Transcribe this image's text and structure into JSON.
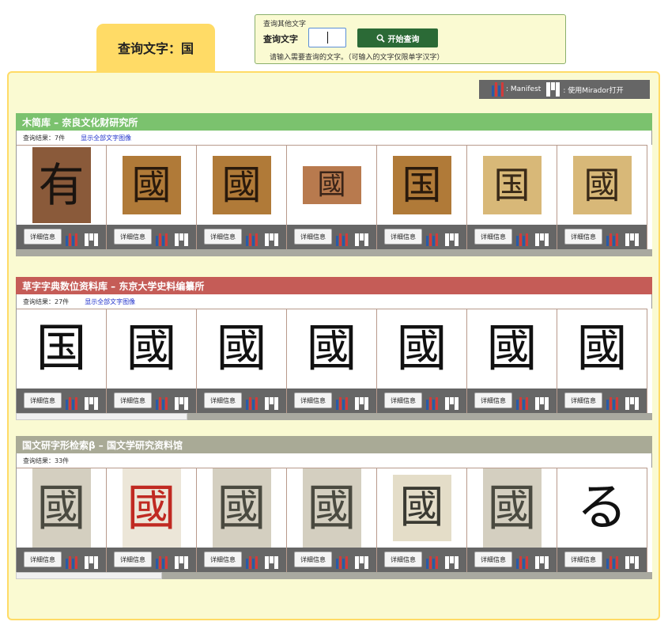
{
  "title_tab": "查询文字：国",
  "search": {
    "title": "查询其他文字",
    "label": "查询文字",
    "value": "",
    "button_label": "开始查询",
    "hint": "请输入需要查询的文字。（可输入的文字仅限单字汉字）"
  },
  "legend": {
    "manifest_label": ": Manifest",
    "mirador_label": ": 使用Mirador打开"
  },
  "colors": {
    "accent_yellow": "#ffdb66",
    "panel_bg": "#fafad2",
    "section1_header": "#7bc26e",
    "section2_header": "#c55c57",
    "section3_header": "#a9aa96",
    "search_button": "#2b6a36"
  },
  "sections": [
    {
      "title": "木简库 – 奈良文化财研究所",
      "result": "查询结果：7件",
      "show_all": "显示全部文字图像",
      "detail_label": "详细信息",
      "cards": [
        {
          "glyph": "有",
          "style": "wood-dark"
        },
        {
          "glyph": "國",
          "style": "wood-mid"
        },
        {
          "glyph": "國",
          "style": "wood-mid"
        },
        {
          "glyph": "國",
          "style": "wood-light"
        },
        {
          "glyph": "国",
          "style": "wood-mid"
        },
        {
          "glyph": "国",
          "style": "wood-pale"
        },
        {
          "glyph": "國",
          "style": "wood-pale"
        }
      ]
    },
    {
      "title": "草字字典数位资料库 – 东京大学史料编纂所",
      "result": "查询结果：27件",
      "show_all": "显示全部文字图像",
      "detail_label": "详細信息",
      "cards": [
        {
          "glyph": "国",
          "style": "ink"
        },
        {
          "glyph": "國",
          "style": "ink"
        },
        {
          "glyph": "國",
          "style": "ink"
        },
        {
          "glyph": "國",
          "style": "ink"
        },
        {
          "glyph": "國",
          "style": "ink"
        },
        {
          "glyph": "國",
          "style": "ink"
        },
        {
          "glyph": "國",
          "style": "ink"
        }
      ]
    },
    {
      "title": "国文研字形检索β – 国文学研究资料馆",
      "result": "查询结果：33件",
      "show_all": "",
      "detail_label": "详細信息",
      "cards": [
        {
          "glyph": "國",
          "style": "paper-grey"
        },
        {
          "glyph": "國",
          "style": "paper-red"
        },
        {
          "glyph": "國",
          "style": "paper-grey"
        },
        {
          "glyph": "國",
          "style": "paper-grey"
        },
        {
          "glyph": "國",
          "style": "paper-light"
        },
        {
          "glyph": "國",
          "style": "paper-grey"
        },
        {
          "glyph": "る",
          "style": "ink"
        }
      ]
    }
  ],
  "scrollbars": [
    {
      "position": 0.0
    },
    {
      "position": 0.27
    },
    {
      "position": 0.23
    }
  ]
}
